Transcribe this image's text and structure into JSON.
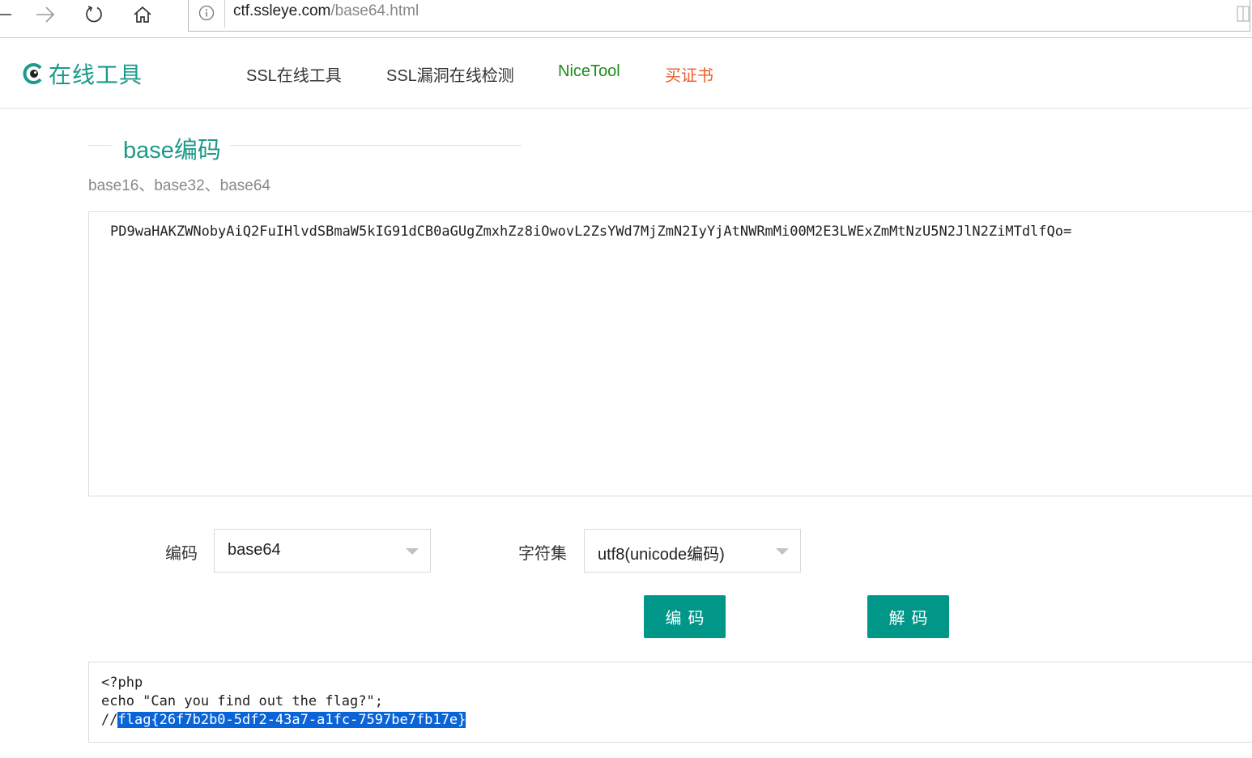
{
  "browser": {
    "url_domain": "ctf.ssleye.com",
    "url_path": "/base64.html"
  },
  "header": {
    "logo_text": "在线工具",
    "nav": [
      {
        "label": "SSL在线工具"
      },
      {
        "label": "SSL漏洞在线检测"
      },
      {
        "label": "NiceTool",
        "color": "#1a8f1a"
      },
      {
        "label": "买证书",
        "color": "#f05a28"
      }
    ]
  },
  "section": {
    "title": "base编码",
    "subtitle": "base16、base32、base64"
  },
  "input": {
    "value": "PD9waHAKZWNobyAiQ2FuIHlvdSBmaW5kIG91dCB0aGUgZmxhZz8iOwovL2ZsYWd7MjZmN2IyYjAtNWRmMi00M2E3LWExZmMtNzU5N2JlN2ZiMTdlfQo="
  },
  "controls": {
    "encoding_label": "编码",
    "encoding_value": "base64",
    "charset_label": "字符集",
    "charset_value": "utf8(unicode编码)",
    "encode_button": "编码",
    "decode_button": "解码"
  },
  "output": {
    "line1": "<?php",
    "line2": "echo \"Can you find out the flag?\";",
    "line3_prefix": "//",
    "line3_selected": "flag{26f7b2b0-5df2-43a7-a1fc-7597be7fb17e}"
  },
  "colors": {
    "accent": "#009688",
    "brand_text": "#1c9a8a",
    "selection": "#0a64d8"
  }
}
